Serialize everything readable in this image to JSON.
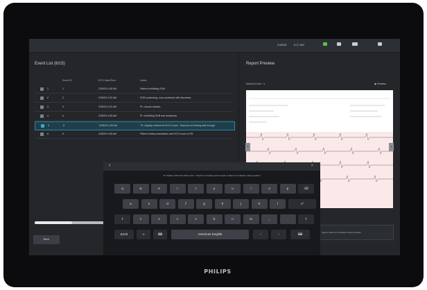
{
  "status_bar": {
    "datetime": "2/28/25",
    "time": "9:17 AM",
    "icons": [
      "status-green-icon",
      "printer-icon",
      "battery-icon",
      "menu-icon"
    ]
  },
  "event_list": {
    "title": "Event List (6/15)",
    "columns": [
      "Event ID",
      "ECG Date/Time",
      "Notes"
    ],
    "rows": [
      {
        "checked": false,
        "index": "1",
        "event_id": "1",
        "datetime": "2/28/25 4:28 AM",
        "notes": "Patient exhibiting SOB",
        "selected": false
      },
      {
        "checked": false,
        "index": "2",
        "event_id": "2",
        "datetime": "2/28/25 4:30 AM",
        "notes": "SOB continuing, now combined with dizziness",
        "selected": false
      },
      {
        "checked": false,
        "index": "3",
        "event_id": "3",
        "datetime": "2/28/25 4:31 AM",
        "notes": "Pt. reports nausea",
        "selected": false
      },
      {
        "checked": false,
        "index": "4",
        "event_id": "4",
        "datetime": "2/28/25 4:35 AM",
        "notes": "Pt. exhibiting SOB and weakness",
        "selected": false
      },
      {
        "checked": true,
        "index": "5",
        "event_id": "5",
        "datetime": "2/28/25 4:35 AM",
        "notes": "Pt. slightly reclined for ECG exam - Reports not feeling well enough",
        "selected": true
      },
      {
        "checked": false,
        "index": "6",
        "event_id": "6",
        "datetime": "2/28/25 4:35 AM",
        "notes": "Patient initial presentation and ECG exam in ER",
        "selected": false
      }
    ]
  },
  "report_preview": {
    "title": "Report Preview",
    "marked_event": "Marked Event : 5",
    "preview_label": "Preview"
  },
  "footer": {
    "back_label": "Back",
    "progress": 0.45,
    "message_fragment": "ough to adopt a completely supine position"
  },
  "keyboard": {
    "text": "Pt. slightly reclined for ECG exam - Reports not feeling well enough to adopt a completely supine position",
    "prev_arrow": "‹",
    "next_arrow": "›",
    "row1": [
      "q",
      "w",
      "e",
      "r",
      "t",
      "y",
      "u",
      "i",
      "o",
      "p"
    ],
    "row2": [
      "a",
      "s",
      "d",
      "f",
      "g",
      "h",
      "j",
      "k",
      "l"
    ],
    "row3": [
      "z",
      "x",
      "c",
      "v",
      "b",
      "n",
      "m",
      ",",
      "."
    ],
    "backspace": "⌫",
    "enter": "⏎",
    "shift": "⇧",
    "numbers": "&123",
    "emoji": "☺",
    "space": "American English",
    "left_arrow": "‹",
    "right_arrow": "›",
    "hide": "⌨"
  },
  "brand": "PHILIPS"
}
